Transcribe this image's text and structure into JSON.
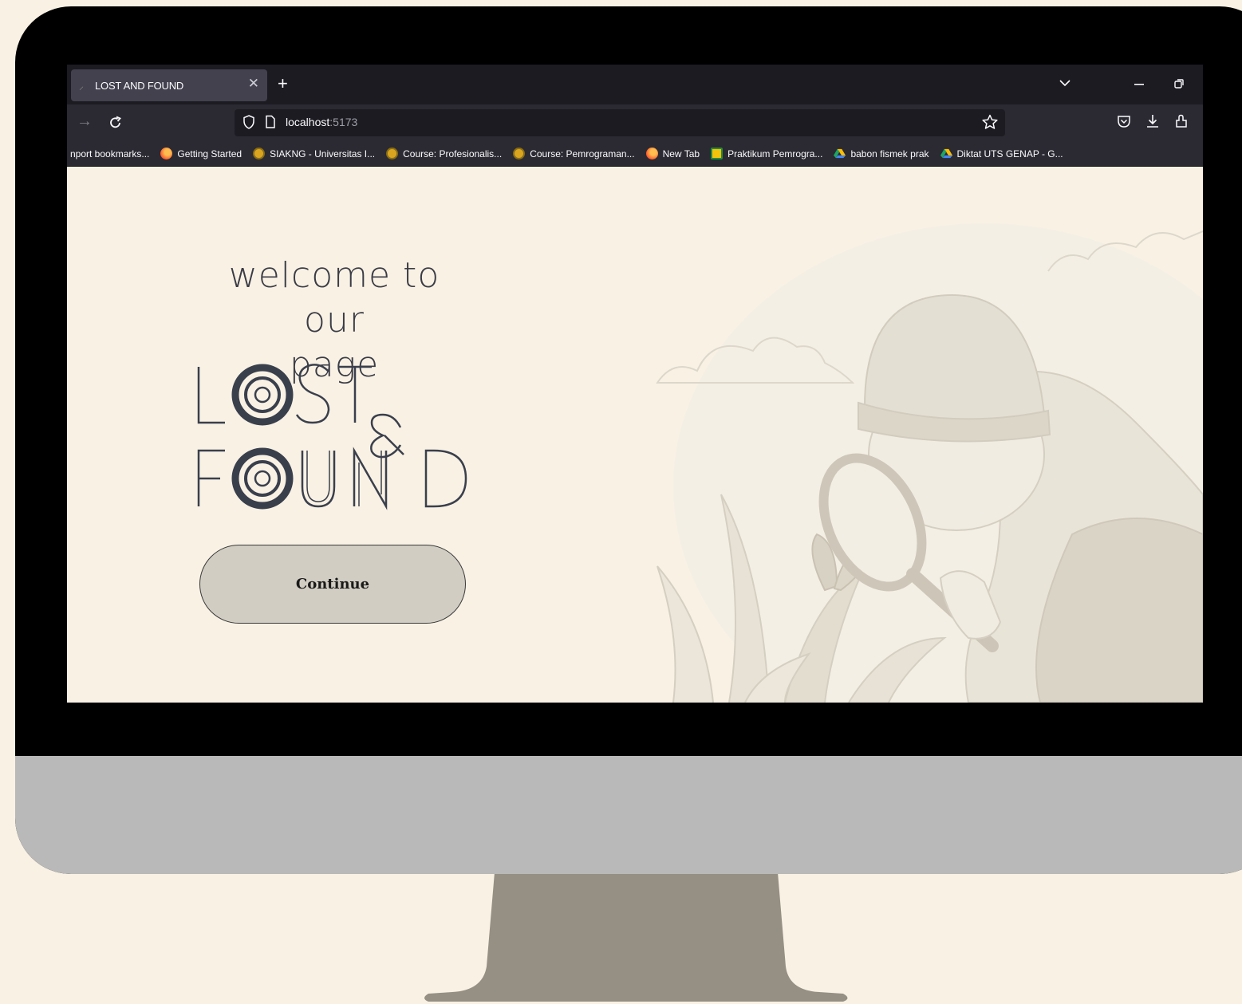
{
  "browser": {
    "tab": {
      "title": "LOST AND FOUND"
    },
    "url": {
      "host": "localhost",
      "port": ":5173"
    },
    "bookmarks": [
      {
        "label": "nport bookmarks...",
        "icon": "none"
      },
      {
        "label": "Getting Started",
        "icon": "firefox-icon"
      },
      {
        "label": "SIAKNG - Universitas I...",
        "icon": "university-icon"
      },
      {
        "label": "Course: Profesionalis...",
        "icon": "university-icon"
      },
      {
        "label": "Course: Pemrograman...",
        "icon": "university-icon"
      },
      {
        "label": "New Tab",
        "icon": "firefox-icon"
      },
      {
        "label": "Praktikum Pemrogra...",
        "icon": "classroom-icon"
      },
      {
        "label": "babon fismek prak",
        "icon": "drive-icon"
      },
      {
        "label": "Diktat UTS GENAP - G...",
        "icon": "drive-icon"
      }
    ]
  },
  "page": {
    "welcome_line1": "welcome to our",
    "welcome_line2": "page",
    "logo": {
      "line1": "LOST",
      "ampersand": "&",
      "line2": "FOUND"
    },
    "continue_label": "Continue"
  },
  "colors": {
    "background": "#f8f1e4",
    "monitor": "#000000",
    "chin": "#b9b9b9",
    "stand": "#968f84",
    "button": "#d1cdc3",
    "logo_ink": "#3a3f4c"
  }
}
